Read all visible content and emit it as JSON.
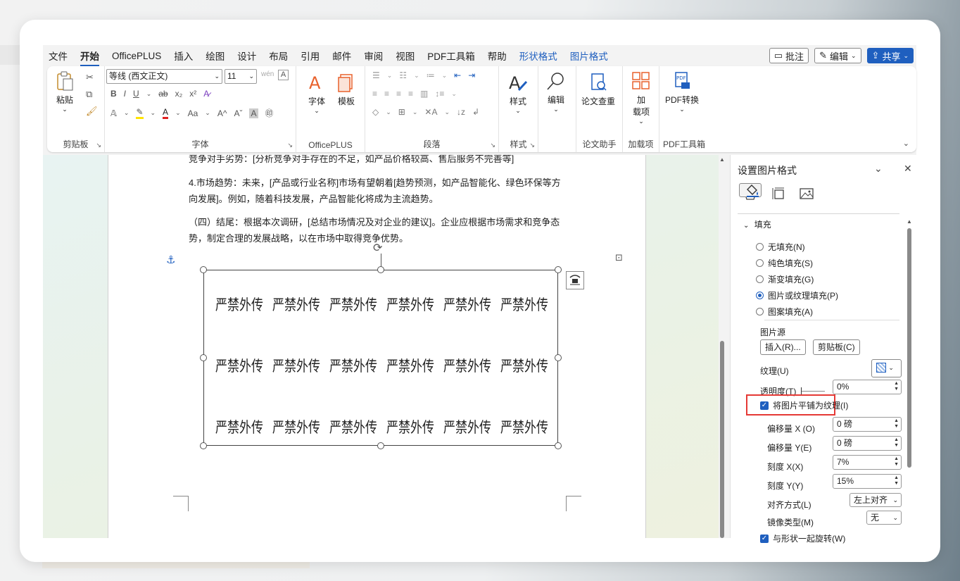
{
  "menu": {
    "tabs": [
      "文件",
      "开始",
      "OfficePLUS",
      "插入",
      "绘图",
      "设计",
      "布局",
      "引用",
      "邮件",
      "审阅",
      "视图",
      "PDF工具箱",
      "帮助"
    ],
    "active_tab": "开始",
    "context_tabs": [
      "形状格式",
      "图片格式"
    ],
    "comment_label": "批注",
    "edit_label": "编辑",
    "share_label": "共享"
  },
  "ribbon": {
    "clipboard": {
      "paste": "粘贴",
      "group": "剪贴板"
    },
    "font": {
      "name": "等线 (西文正文)",
      "size": "11",
      "group": "字体"
    },
    "officeplus": {
      "font_btn": "字体",
      "template_btn": "模板",
      "group": "OfficePLUS"
    },
    "paragraph": {
      "group": "段落"
    },
    "styles": {
      "btn": "样式",
      "group": "样式"
    },
    "editing": {
      "btn": "编辑"
    },
    "paper": {
      "btn": "论文查重",
      "group": "论文助手"
    },
    "addins": {
      "btn_line1": "加",
      "btn_line2": "载项",
      "group": "加载项"
    },
    "pdf": {
      "btn": "PDF转换",
      "group": "PDF工具箱"
    }
  },
  "document": {
    "paragraphs": [
      "竞争对手劣势：[分析竞争对手存在的不足，如产品价格较高、售后服务不完善等]",
      "4.市场趋势：未来，[产品或行业名称]市场有望朝着[趋势预测，如产品智能化、绿色环保等方向发展]。例如，随着科技发展，产品智能化将成为主流趋势。",
      "（四）结尾：根据本次调研，[总结市场情况及对企业的建议]。企业应根据市场需求和竞争态势，制定合理的发展战略，以在市场中取得竞争优势。"
    ],
    "watermark_text": "严禁外传",
    "watermark_rows": 3,
    "watermark_cols": 6
  },
  "pane": {
    "title": "设置图片格式",
    "section": "填充",
    "fill_options": [
      {
        "label": "无填充(N)",
        "selected": false
      },
      {
        "label": "纯色填充(S)",
        "selected": false
      },
      {
        "label": "渐变填充(G)",
        "selected": false
      },
      {
        "label": "图片或纹理填充(P)",
        "selected": true
      },
      {
        "label": "图案填充(A)",
        "selected": false
      }
    ],
    "picture_source": "图片源",
    "insert_btn": "插入(R)...",
    "clipboard_btn": "剪贴板(C)",
    "texture_label": "纹理(U)",
    "transparency_label": "透明度(T)",
    "transparency_value": "0%",
    "tile_label": "将图片平铺为纹理(I)",
    "offset_x_label": "偏移量 X (O)",
    "offset_x_value": "0 磅",
    "offset_y_label": "偏移量 Y(E)",
    "offset_y_value": "0 磅",
    "scale_x_label": "刻度 X(X)",
    "scale_x_value": "7%",
    "scale_y_label": "刻度 Y(Y)",
    "scale_y_value": "15%",
    "align_label": "对齐方式(L)",
    "align_value": "左上对齐",
    "mirror_label": "镜像类型(M)",
    "mirror_value": "无",
    "rotate_label": "与形状一起旋转(W)"
  },
  "colors": {
    "accent": "#1f5fbf",
    "highlight": "#e53935"
  }
}
